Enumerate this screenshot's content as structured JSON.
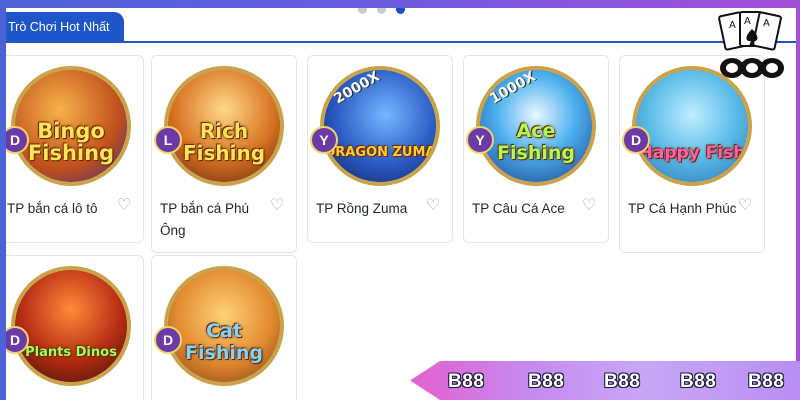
{
  "carousel": {
    "dots": 3,
    "active": 2
  },
  "section_tab": {
    "label": "Trò Chơi Hot Nhất"
  },
  "games": [
    {
      "title": "TP bắn cá lô tô",
      "logo": "Bingo Fishing",
      "provider": "D",
      "mult": "",
      "theme": "bingo"
    },
    {
      "title": "TP bắn cá Phú Ông",
      "logo": "Rich Fishing",
      "provider": "L",
      "mult": "",
      "theme": "rich"
    },
    {
      "title": "TP Rồng Zuma",
      "logo": "DRAGON ZUMA",
      "provider": "Y",
      "mult": "2000X",
      "theme": "dragon"
    },
    {
      "title": "TP Câu Cá Ace",
      "logo": "Ace Fishing",
      "provider": "Y",
      "mult": "1000X",
      "theme": "ace"
    },
    {
      "title": "TP Cá Hạnh Phúc",
      "logo": "Happy Fish",
      "provider": "D",
      "mult": "",
      "theme": "happy"
    },
    {
      "title": "",
      "logo": "Plants Dinos",
      "provider": "D",
      "mult": "",
      "theme": "plants"
    },
    {
      "title": "",
      "logo": "Cat Fishing",
      "provider": "D",
      "mult": "",
      "theme": "cat"
    }
  ],
  "ribbon": {
    "items": [
      "B88",
      "B88",
      "B88",
      "B88",
      "B88"
    ]
  },
  "colors": {
    "accent": "#1e55c8",
    "ribbon_start": "#e35fd0",
    "ribbon_end": "#b98ef4"
  }
}
